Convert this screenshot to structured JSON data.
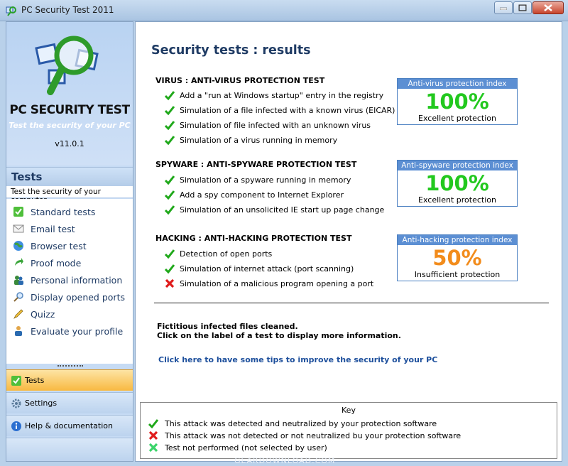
{
  "window": {
    "title": "PC Security Test 2011"
  },
  "sidebar": {
    "logo_title": "PC SECURITY TEST",
    "logo_subtitle": "Test the security of your PC",
    "version": "v11.0.1",
    "tests_header": "Tests",
    "tests_description": "Test the security of your computer",
    "menu": [
      {
        "label": "Standard tests",
        "icon": "check-icon"
      },
      {
        "label": "Email test",
        "icon": "envelope-icon"
      },
      {
        "label": "Browser test",
        "icon": "globe-icon"
      },
      {
        "label": "Proof mode",
        "icon": "arrow-icon"
      },
      {
        "label": "Personal information",
        "icon": "users-icon"
      },
      {
        "label": "Display opened ports",
        "icon": "magnifier-icon"
      },
      {
        "label": "Quizz",
        "icon": "pencil-icon"
      },
      {
        "label": "Evaluate your profile",
        "icon": "person-icon"
      }
    ],
    "nav": [
      {
        "label": "Tests",
        "icon": "check-icon",
        "active": true
      },
      {
        "label": "Settings",
        "icon": "gear-icon",
        "active": false
      },
      {
        "label": "Help & documentation",
        "icon": "info-icon",
        "active": false
      }
    ]
  },
  "main": {
    "title": "Security tests : results",
    "sections": [
      {
        "title": "VIRUS : ANTI-VIRUS PROTECTION TEST",
        "tests": [
          {
            "label": "Add a \"run at Windows startup\" entry in the registry",
            "status": "detected"
          },
          {
            "label": "Simulation of a file infected with a known virus (EICAR)",
            "status": "detected"
          },
          {
            "label": "Simulation of file infected with an unknown virus",
            "status": "detected"
          },
          {
            "label": "Simulation of a virus running in memory",
            "status": "detected"
          }
        ],
        "index": {
          "header": "Anti-virus protection index",
          "value": "100%",
          "label": "Excellent protection",
          "color": "#22c81e"
        }
      },
      {
        "title": "SPYWARE : ANTI-SPYWARE PROTECTION TEST",
        "tests": [
          {
            "label": "Simulation of a spyware running in memory",
            "status": "detected"
          },
          {
            "label": "Add a spy component to Internet Explorer",
            "status": "detected"
          },
          {
            "label": "Simulation of an unsolicited IE start up page change",
            "status": "detected"
          }
        ],
        "index": {
          "header": "Anti-spyware protection index",
          "value": "100%",
          "label": "Excellent protection",
          "color": "#22c81e"
        }
      },
      {
        "title": "HACKING : ANTI-HACKING PROTECTION TEST",
        "tests": [
          {
            "label": "Detection of open ports",
            "status": "detected"
          },
          {
            "label": "Simulation of internet attack (port scanning)",
            "status": "detected"
          },
          {
            "label": "Simulation of a malicious program opening a port",
            "status": "failed"
          }
        ],
        "index": {
          "header": "Anti-hacking protection index",
          "value": "50%",
          "label": "Insufficient protection",
          "color": "#f28c1c"
        }
      }
    ],
    "notice_line1": "Fictitious infected files cleaned.",
    "notice_line2": "Click on the label of a test to display more information.",
    "tips_link": "Click here to have some tips to improve the security of your PC",
    "key": {
      "title": "Key",
      "rows": [
        {
          "label": "This attack was detected and neutralized by your protection software",
          "status": "detected"
        },
        {
          "label": "This attack was not detected or not neutralized bu your protection software",
          "status": "failed"
        },
        {
          "label": "Test not performed (not selected by user)",
          "status": "not-performed"
        }
      ]
    }
  },
  "colors": {
    "pass": "#1fa81a",
    "fail": "#e01b1b",
    "not_performed": "#3ad46a",
    "accent": "#1f3b64"
  },
  "watermark": "GEARDOWNLOAD.COM"
}
